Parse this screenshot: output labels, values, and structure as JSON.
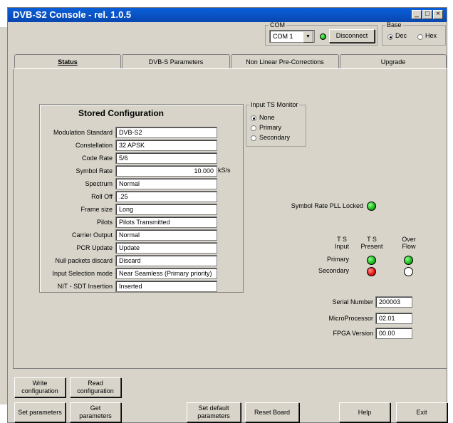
{
  "window": {
    "title": "DVB-S2 Console - rel. 1.0.5",
    "min_label": "_",
    "max_label": "□",
    "close_label": "×"
  },
  "com": {
    "legend": "COM",
    "selected": "COM 1",
    "disconnect_label": "Disconnect"
  },
  "base": {
    "legend": "Base",
    "options": [
      "Dec",
      "Hex"
    ],
    "selected": "Dec"
  },
  "tabs": [
    {
      "label": "Status",
      "active": true
    },
    {
      "label": "DVB-S Parameters",
      "active": false
    },
    {
      "label": "Non Linear Pre-Corrections",
      "active": false
    },
    {
      "label": "Upgrade",
      "active": false
    }
  ],
  "stored": {
    "title": "Stored Configuration",
    "rows": [
      {
        "label": "Modulation Standard",
        "value": "DVB-S2"
      },
      {
        "label": "Constellation",
        "value": "32 APSK"
      },
      {
        "label": "Code Rate",
        "value": "5/6"
      },
      {
        "label": "Symbol Rate",
        "value": "10.000",
        "unit": "kS/s"
      },
      {
        "label": "Spectrum",
        "value": "Normal"
      },
      {
        "label": "Roll Off",
        "value": ".25"
      },
      {
        "label": "Frame size",
        "value": "Long"
      },
      {
        "label": "Pilots",
        "value": "Pilots Transmitted"
      },
      {
        "label": "Carrier Output",
        "value": "Normal"
      },
      {
        "label": "PCR Update",
        "value": "Update"
      },
      {
        "label": "Null packets discard",
        "value": "Discard"
      },
      {
        "label": "Input Selection mode",
        "value": "Near Seamless (Primary priority)"
      },
      {
        "label": "NIT - SDT Insertion",
        "value": "Inserted"
      }
    ]
  },
  "ts_monitor": {
    "legend": "Input TS Monitor",
    "options": [
      "None",
      "Primary",
      "Secondary"
    ],
    "selected": "None"
  },
  "pll": {
    "label": "Symbol Rate PLL Locked",
    "status_color": "#17b317"
  },
  "ts_table": {
    "headers": [
      [
        "T S",
        "Input"
      ],
      [
        "T S",
        "Present"
      ],
      [
        "Over",
        "Flow"
      ]
    ],
    "rows": [
      {
        "label": "Primary",
        "present": "green",
        "overflow": "green"
      },
      {
        "label": "Secondary",
        "present": "red",
        "overflow": "off"
      }
    ]
  },
  "info": [
    {
      "label": "Serial Number",
      "value": "200003"
    },
    {
      "label": "MicroProcessor",
      "value": "02.01"
    },
    {
      "label": "FPGA Version",
      "value": "00.00"
    }
  ],
  "buttons": {
    "write_config": [
      "Write",
      "configuration"
    ],
    "read_config": [
      "Read",
      "configuration"
    ],
    "set_params": "Set parameters",
    "get_params": [
      "Get",
      "parameters"
    ],
    "set_default": [
      "Set default",
      "parameters"
    ],
    "reset_board": "Reset Board",
    "help": "Help",
    "exit": "Exit"
  }
}
